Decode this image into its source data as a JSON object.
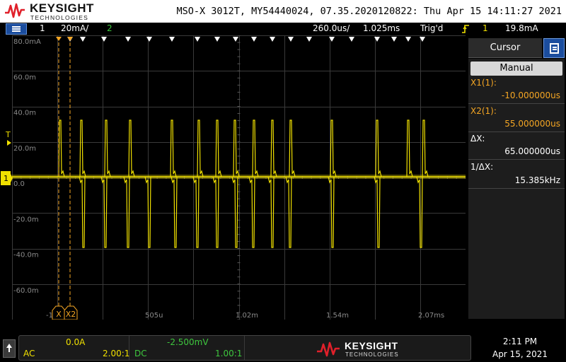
{
  "header": {
    "brand_name": "KEYSIGHT",
    "brand_sub": "TECHNOLOGIES",
    "instrument_line": "MSO-X 3012T, MY54440024, 07.35.2020120822: Thu Apr 15 14:11:27 2021"
  },
  "statusbar": {
    "ch1_num": "1",
    "ch1_scale": "20mA/",
    "ch2_num": "2",
    "time_per_div": "260.0us/",
    "delay": "1.025ms",
    "trigger_state": "Trig'd",
    "trigger_channel": "1",
    "trigger_level": "19.8mA"
  },
  "graticule": {
    "y_labels": [
      "80.0mA",
      "60.0m",
      "40.0m",
      "20.0m",
      "0.0",
      "-20.0m",
      "-40.0m",
      "-60.0m"
    ],
    "x_labels": [
      "-1",
      "505u",
      "1.02m",
      "1.54m",
      "2.07ms"
    ],
    "trigger_marker": "T",
    "channel_marker": "1",
    "cursor_x1_label": "X",
    "cursor_x2_label": "X2"
  },
  "panel": {
    "title": "Cursor",
    "mode": "Manual",
    "x1_label": "X1(1):",
    "x1_value": "-10.000000us",
    "x2_label": "X2(1):",
    "x2_value": "55.000000us",
    "dx_label": "ΔX:",
    "dx_value": "65.000000us",
    "inv_dx_label": "1/ΔX:",
    "inv_dx_value": "15.385kHz"
  },
  "bottom": {
    "ch1_offset": "0.0A",
    "ch1_coupling": "AC",
    "ch1_probe": "2.00:1",
    "ch2_offset": "-2.500mV",
    "ch2_coupling": "DC",
    "ch2_probe": "1.00:1",
    "brand_name": "KEYSIGHT",
    "brand_sub": "TECHNOLOGIES",
    "time": "2:11 PM",
    "date": "Apr 15, 2021"
  },
  "colors": {
    "ch1": "#f0e000",
    "ch2": "#3ec73e",
    "cursor": "#f5a623",
    "accent_blue": "#1b4d9e",
    "logo_red": "#e0202a"
  }
}
